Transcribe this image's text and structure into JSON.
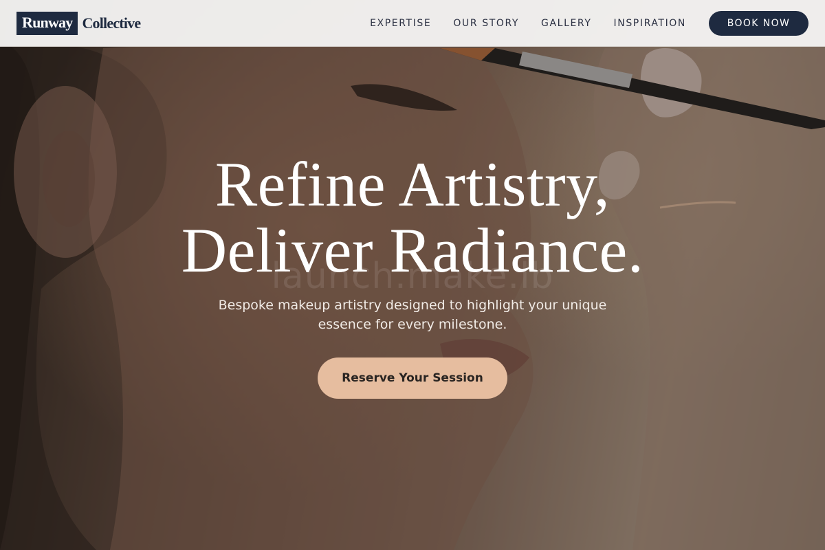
{
  "header": {
    "logo": {
      "box_text": "Runway",
      "text": "Collective"
    },
    "nav": [
      {
        "label": "EXPERTISE"
      },
      {
        "label": "OUR STORY"
      },
      {
        "label": "GALLERY"
      },
      {
        "label": "INSPIRATION"
      }
    ],
    "cta_label": "BOOK NOW"
  },
  "hero": {
    "headline_line1": "Refine Artistry,",
    "headline_line2": "Deliver Radiance.",
    "watermark": "launch.make.lb",
    "subtitle_line1": "Bespoke makeup artistry designed to highlight your unique",
    "subtitle_line2": "essence for every milestone.",
    "cta_label": "Reserve Your Session",
    "image_subject": "woman-profile-makeup-brush-photo"
  },
  "colors": {
    "brand_navy": "#1e2a40",
    "accent_peach": "#e6bd9f",
    "header_bg": "#f3f2f1"
  },
  "icons": []
}
